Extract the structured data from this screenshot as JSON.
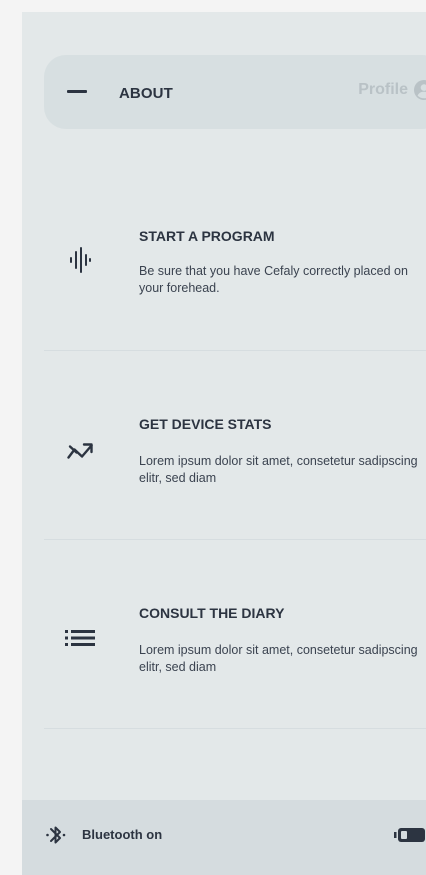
{
  "header": {
    "title": "ABOUT",
    "profile_label": "Profile"
  },
  "cards": [
    {
      "title": "START A PROGRAM",
      "description": "Be sure that you have Cefaly correctly placed on your forehead.",
      "icon": "waveform-icon"
    },
    {
      "title": "GET DEVICE STATS",
      "description": "Lorem ipsum dolor sit amet, consetetur sadipscing elitr, sed diam",
      "icon": "trend-icon"
    },
    {
      "title": "CONSULT THE DIARY",
      "description": "Lorem ipsum dolor sit amet, consetetur sadipscing elitr, sed diam",
      "icon": "list-icon"
    }
  ],
  "footer": {
    "bluetooth_label": "Bluetooth on",
    "bluetooth_icon": "bluetooth-icon",
    "battery_icon": "battery-icon"
  },
  "colors": {
    "panel_bg": "#e3e8e9",
    "header_bg": "#d7dfe1",
    "footer_bg": "#d5dcdf",
    "text_primary": "#2c3441",
    "profile_muted": "#b9c2c6"
  }
}
